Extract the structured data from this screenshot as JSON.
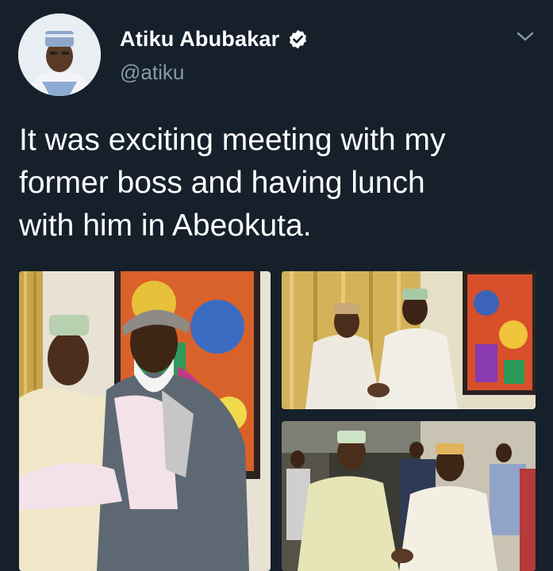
{
  "author": {
    "display_name": "Atiku Abubakar",
    "handle": "@atiku",
    "verified": true,
    "avatar_icon": "profile-photo"
  },
  "tweet": {
    "text": "It was exciting meeting with my\nformer boss and having lunch\nwith him in Abeokuta."
  },
  "menu_icon": "chevron-down-icon",
  "media": [
    {
      "icon": "photo-two-men-in-robes-with-painting"
    },
    {
      "icon": "photo-handshake-in-living-room"
    },
    {
      "icon": "photo-greeting-in-hallway"
    }
  ],
  "colors": {
    "background": "#15202b",
    "text": "#ffffff",
    "secondary_text": "#8899a6"
  }
}
